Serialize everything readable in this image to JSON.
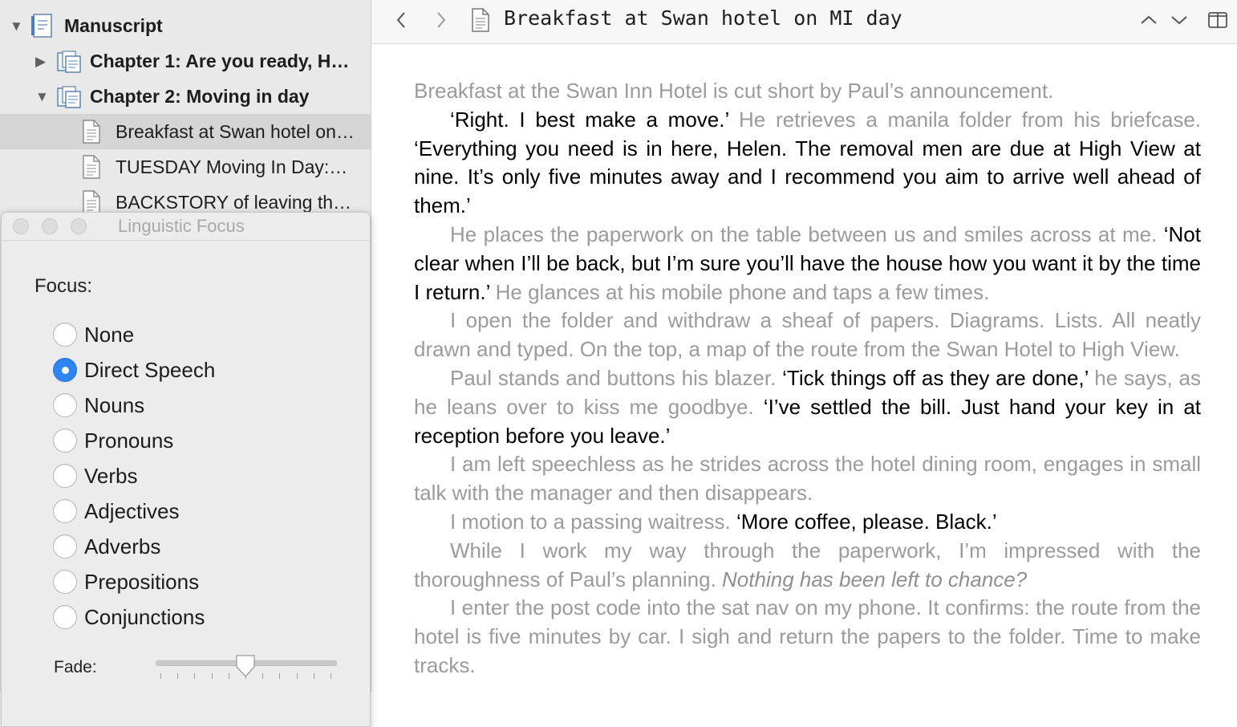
{
  "binder": {
    "items": [
      {
        "label": "Manuscript",
        "bold": true,
        "level": 0,
        "disclosure": "expanded",
        "icon": "manuscript-icon"
      },
      {
        "label": "Chapter 1: Are you ready, H…",
        "bold": true,
        "level": 1,
        "disclosure": "collapsed",
        "icon": "folder-icon"
      },
      {
        "label": "Chapter 2: Moving in day",
        "bold": true,
        "level": 1,
        "disclosure": "expanded",
        "icon": "folder-icon"
      },
      {
        "label": "Breakfast at Swan hotel on…",
        "bold": false,
        "level": 2,
        "disclosure": "none",
        "icon": "document-icon",
        "selected": true
      },
      {
        "label": "TUESDAY Moving In Day:…",
        "bold": false,
        "level": 2,
        "disclosure": "none",
        "icon": "document-icon"
      },
      {
        "label": "BACKSTORY of leaving th…",
        "bold": false,
        "level": 2,
        "disclosure": "none",
        "icon": "document-icon"
      }
    ]
  },
  "editor": {
    "title": "Breakfast at Swan hotel on MI day",
    "nav": {
      "back_icon": "chevron-left-icon",
      "forward_icon": "chevron-right-icon",
      "prev_icon": "chevron-up-icon",
      "next_icon": "chevron-down-icon",
      "split_icon": "split-view-icon"
    },
    "paragraphs": [
      {
        "indent": false,
        "runs": [
          {
            "t": "Breakfast at the Swan Inn Hotel is cut short by Paul’s announcement.",
            "s": "dim"
          }
        ]
      },
      {
        "indent": true,
        "runs": [
          {
            "t": "‘Right. I best make a move.’ ",
            "s": "speech"
          },
          {
            "t": "He retrieves a manila folder from his briefcase. ",
            "s": "dim"
          },
          {
            "t": "‘Everything you need is in here, Helen. The removal men are due at High View at nine. It’s only five minutes away and I recommend you aim to arrive well ahead of them.’",
            "s": "speech"
          }
        ]
      },
      {
        "indent": true,
        "runs": [
          {
            "t": "He places the paperwork on the table between us and smiles across at me. ",
            "s": "dim"
          },
          {
            "t": "‘Not clear when I’ll be back, but I’m sure you’ll have the house how you want it by the time I return.’ ",
            "s": "speech"
          },
          {
            "t": "He glances at his mobile phone and taps a few times.",
            "s": "dim"
          }
        ]
      },
      {
        "indent": true,
        "runs": [
          {
            "t": "I open the folder and withdraw a sheaf of papers. Diagrams. Lists. All neatly drawn and typed. On the top, a map of the route from the Swan Hotel to High View.",
            "s": "dim"
          }
        ]
      },
      {
        "indent": true,
        "runs": [
          {
            "t": "Paul stands and buttons his blazer. ",
            "s": "dim"
          },
          {
            "t": "‘Tick things off as they are done,’ ",
            "s": "speech"
          },
          {
            "t": "he says, as he leans over to kiss me goodbye. ",
            "s": "dim"
          },
          {
            "t": "‘I’ve settled the bill. Just hand your key in at reception before you leave.’",
            "s": "speech"
          }
        ]
      },
      {
        "indent": true,
        "runs": [
          {
            "t": "I am left speechless as he strides across the hotel dining room, engages in small talk with the manager and then disappears.",
            "s": "dim"
          }
        ]
      },
      {
        "indent": true,
        "runs": [
          {
            "t": "I motion to a passing waitress. ",
            "s": "dim"
          },
          {
            "t": "‘More coffee, please. Black.’",
            "s": "speech"
          }
        ]
      },
      {
        "indent": true,
        "runs": [
          {
            "t": "While I work my way through the paperwork, I’m impressed with the thoroughness of Paul’s planning. ",
            "s": "dim"
          },
          {
            "t": "Nothing has been left to chance?",
            "s": "italic"
          }
        ]
      },
      {
        "indent": true,
        "runs": [
          {
            "t": "I enter the post code into the sat nav on my phone. It confirms: the route from the hotel is five minutes by car. I sigh and return the papers to the folder. Time to make tracks.",
            "s": "dim"
          }
        ]
      }
    ]
  },
  "panel": {
    "title": "Linguistic Focus",
    "focus_label": "Focus:",
    "options": [
      "None",
      "Direct Speech",
      "Nouns",
      "Pronouns",
      "Verbs",
      "Adjectives",
      "Adverbs",
      "Prepositions",
      "Conjunctions"
    ],
    "selected": "Direct Speech",
    "fade_label": "Fade:",
    "fade_value": 0.5
  },
  "colors": {
    "accent": "#2f84f6",
    "speech_text": "#000000",
    "faded_text": "#9b9b9b",
    "selection": "#d5d5d5"
  }
}
